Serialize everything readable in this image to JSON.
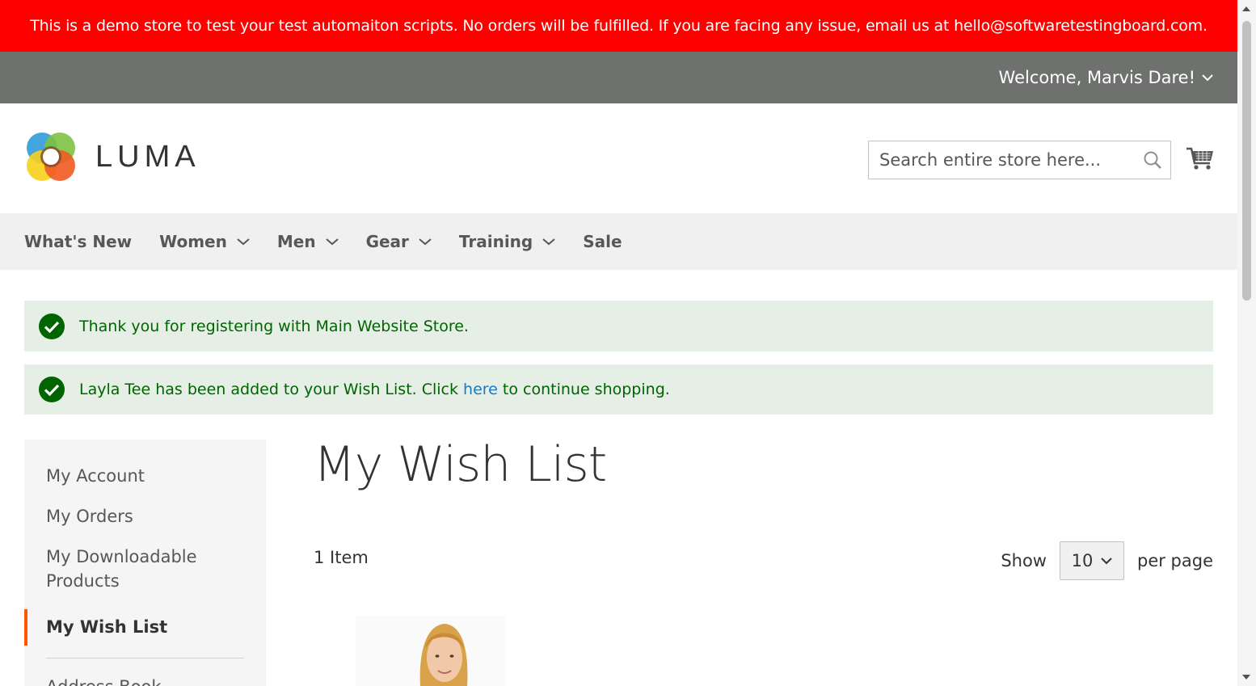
{
  "banner": {
    "text": "This is a demo store to test your test automaiton scripts. No orders will be fulfilled. If you are facing any issue, email us at hello@softwaretestingboard.com."
  },
  "topbar": {
    "welcome": "Welcome, Marvis Dare!"
  },
  "header": {
    "logo_text": "LUMA",
    "search_placeholder": "Search entire store here..."
  },
  "nav": {
    "items": [
      {
        "label": "What's New",
        "has_dropdown": false
      },
      {
        "label": "Women",
        "has_dropdown": true
      },
      {
        "label": "Men",
        "has_dropdown": true
      },
      {
        "label": "Gear",
        "has_dropdown": true
      },
      {
        "label": "Training",
        "has_dropdown": true
      },
      {
        "label": "Sale",
        "has_dropdown": false
      }
    ]
  },
  "messages": {
    "registered": "Thank you for registering with Main Website Store.",
    "wishlist_prefix": "Layla Tee has been added to your Wish List. Click ",
    "wishlist_link": "here",
    "wishlist_suffix": " to continue shopping."
  },
  "sidebar": {
    "items": [
      {
        "label": "My Account"
      },
      {
        "label": "My Orders"
      },
      {
        "label": "My Downloadable Products"
      },
      {
        "label": "My Wish List",
        "active": true
      },
      {
        "label": "Address Book"
      }
    ]
  },
  "main": {
    "title": "My Wish List",
    "item_count": "1 Item",
    "show_label": "Show",
    "per_page_value": "10",
    "per_page_label": "per page"
  },
  "colors": {
    "banner": "#ff0000",
    "topbar": "#6e716e",
    "nav_bg": "#f0f0f0",
    "success_bg": "#e5efe5",
    "success_text": "#006400",
    "link": "#1979c3",
    "active_accent": "#ff5501"
  }
}
